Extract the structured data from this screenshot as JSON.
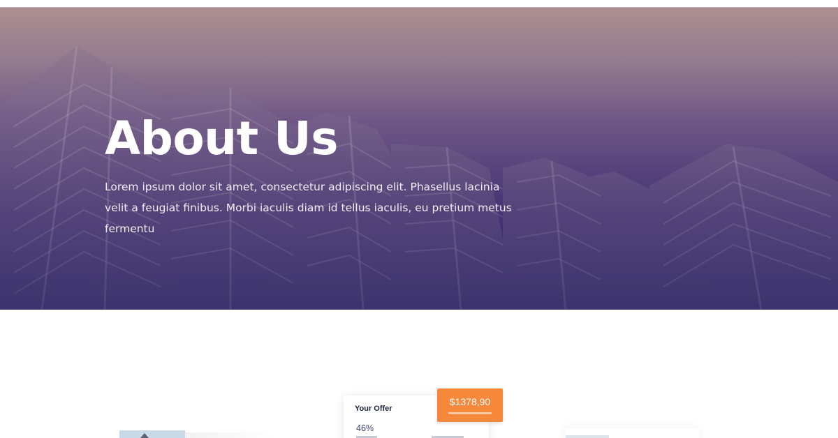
{
  "hero": {
    "title": "About Us",
    "description": "Lorem ipsum dolor sit amet, consectetur adipiscing elit. Phasellus lacinia velit a feugiat finibus. Morbi iaculis diam id tellus iaculis, eu pretium metus fermentu",
    "gradient_top": "#a98c8f",
    "gradient_bottom": "#2f2a66"
  },
  "preview": {
    "offer_title": "Your Offer",
    "offer_percent": "46%",
    "price": "$1378,90",
    "badge_color": "#f5883a"
  }
}
